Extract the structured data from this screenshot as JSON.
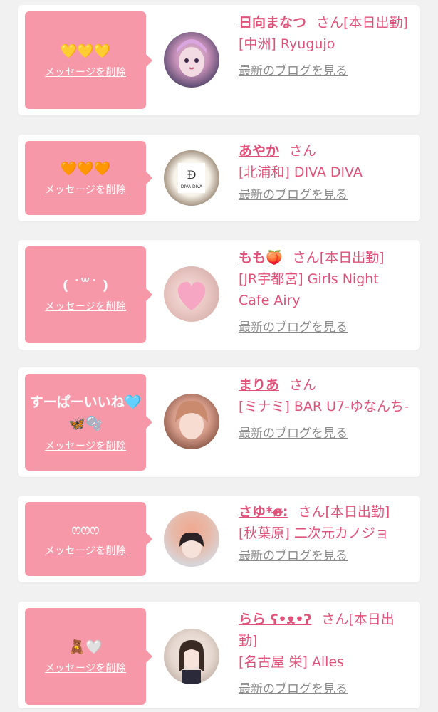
{
  "cards": [
    {
      "message": "💛💛💛",
      "delete_label": "メッセージを削除",
      "name": "日向まなつ",
      "san": "さん",
      "status": "[本日出勤]",
      "shop": "[中洲] Ryugujo",
      "blog_label": "最新のブログを見る"
    },
    {
      "message": "🧡🧡🧡",
      "delete_label": "メッセージを削除",
      "name": "あやか",
      "san": "さん",
      "status": "",
      "shop": "[北浦和] DIVA DIVA",
      "blog_label": "最新のブログを見る",
      "avatar_text": "DIVA DIVA"
    },
    {
      "message": "( ˙꒳˙ )",
      "delete_label": "メッセージを削除",
      "name": "もも🍑",
      "san": "さん",
      "status": "[本日出勤]",
      "shop": "[JR宇都宮] Girls Night Cafe Airy",
      "blog_label": "最新のブログを見る"
    },
    {
      "message": "すーぱーいいね🩵🦋🫧",
      "delete_label": "メッセージを削除",
      "name": "まりあ",
      "san": "さん",
      "status": "",
      "shop": "[ミナミ] BAR U7-ゆなんち-",
      "blog_label": "最新のブログを見る"
    },
    {
      "message": "ෆෆෆ",
      "delete_label": "メッセージを削除",
      "name": "さゆ*ɞ̴̶̷:",
      "san": "さん",
      "status": "[本日出勤]",
      "shop": "[秋葉原] 二次元カノジョ",
      "blog_label": "最新のブログを見る"
    },
    {
      "message": "🧸🤍",
      "delete_label": "メッセージを削除",
      "name": "らら ʕ•ᴥ•ʔ",
      "san": "さん",
      "status": "[本日出勤]",
      "shop": "[名古屋 栄] Alles",
      "blog_label": "最新のブログを見る"
    }
  ],
  "colors": {
    "bubble": "#f798a8",
    "accent": "#e0527a",
    "link_gray": "#8a8a8a",
    "background": "#f1f1f1"
  }
}
